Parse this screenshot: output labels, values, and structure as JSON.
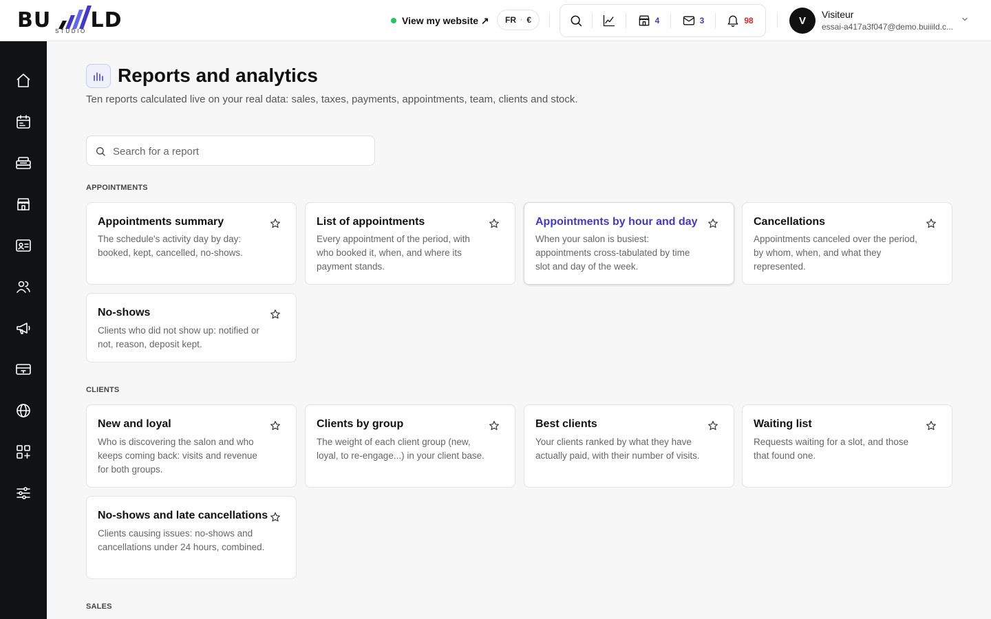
{
  "brand": {
    "logo_text": "BUILD",
    "logo_sub": "STUDIO"
  },
  "header": {
    "site_link": "View my website ↗",
    "language": "FR",
    "currency": "€",
    "tools": [
      {
        "name": "search-icon",
        "count": ""
      },
      {
        "name": "chart-icon",
        "count": ""
      },
      {
        "name": "store-icon",
        "count": "4"
      },
      {
        "name": "mail-icon",
        "count": "3"
      },
      {
        "name": "bell-icon",
        "count": "98"
      }
    ],
    "user": {
      "initial": "V",
      "name": "Visiteur",
      "email": "essai-a417a3f047@demo.buiiild.c..."
    }
  },
  "sidebar": {
    "items": [
      "home-icon",
      "calendar-icon",
      "register-icon",
      "store-icon",
      "contact-card-icon",
      "users-icon",
      "megaphone-icon",
      "card-icon",
      "globe-icon",
      "apps-icon",
      "settings-icon"
    ]
  },
  "page": {
    "title": "Reports and analytics",
    "description": "Ten reports calculated live on your real data: sales, taxes, payments, appointments, team, clients and stock.",
    "search_placeholder": "Search for a report"
  },
  "sections": [
    {
      "label": "APPOINTMENTS",
      "cards": [
        {
          "title": "Appointments summary",
          "desc": "The schedule's activity day by day: booked, kept, cancelled, no-shows."
        },
        {
          "title": "List of appointments",
          "desc": "Every appointment of the period, with who booked it, when, and where its payment stands."
        },
        {
          "title": "Appointments by hour and day",
          "desc": "When your salon is busiest: appointments cross-tabulated by time slot and day of the week."
        },
        {
          "title": "Cancellations",
          "desc": "Appointments canceled over the period, by whom, when, and what they represented."
        },
        {
          "title": "No-shows",
          "desc": "Clients who did not show up: notified or not, reason, deposit kept."
        }
      ]
    },
    {
      "label": "CLIENTS",
      "cards": [
        {
          "title": "New and loyal",
          "desc": "Who is discovering the salon and who keeps coming back: visits and revenue for both groups."
        },
        {
          "title": "Clients by group",
          "desc": "The weight of each client group (new, loyal, to re-engage...) in your client base."
        },
        {
          "title": "Best clients",
          "desc": "Your clients ranked by what they have actually paid, with their number of visits."
        },
        {
          "title": "Waiting list",
          "desc": "Requests waiting for a slot, and those that found one."
        },
        {
          "title": "No-shows and late cancellations",
          "desc": "Clients causing issues: no-shows and cancellations under 24 hours, combined."
        }
      ]
    },
    {
      "label": "SALES",
      "cards": []
    }
  ],
  "colors": {
    "accent": "#4338ca",
    "sidebar_bg": "#111214",
    "status_green": "#22c55e",
    "alert_red": "#dc2626"
  }
}
